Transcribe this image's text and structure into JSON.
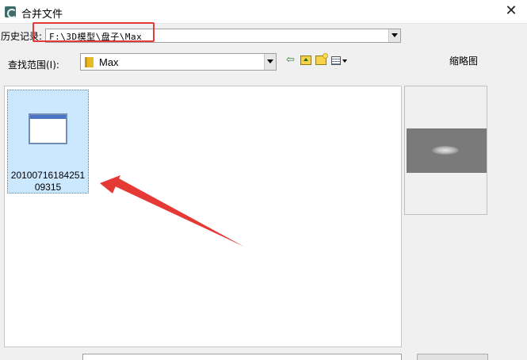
{
  "window": {
    "title": "合并文件"
  },
  "history": {
    "label": "历史记录:",
    "value": "F:\\3D模型\\盘子\\Max"
  },
  "look_in": {
    "label": "查找范围(I):",
    "value": "Max"
  },
  "thumbnail": {
    "label": "缩略图"
  },
  "files": [
    {
      "name": "20100716184251 09315"
    }
  ],
  "toolbar_icons": [
    "back-icon",
    "up-folder-icon",
    "new-folder-icon",
    "view-menu-icon"
  ],
  "colors": {
    "highlight_box": "#e53935",
    "annotation_arrow": "#e53935",
    "selection": "#cce8ff"
  }
}
